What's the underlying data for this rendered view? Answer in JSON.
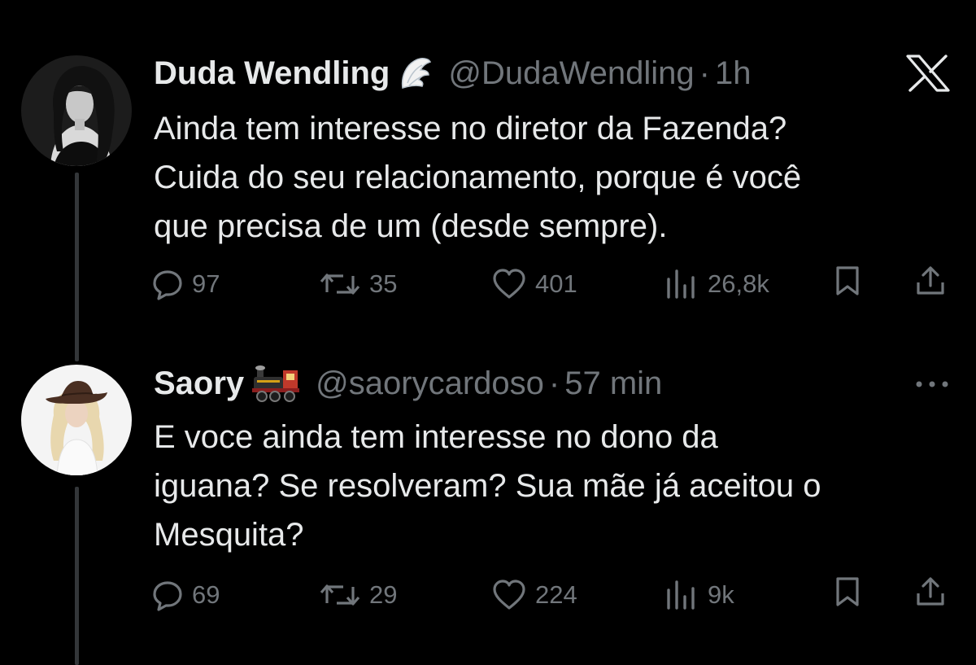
{
  "tweets": [
    {
      "display_name": "Duda Wendling",
      "badge_icon": "angel-wing-emoji",
      "handle": "@DudaWendling",
      "separator": "·",
      "time": "1h",
      "text_lines": [
        "Ainda tem interesse no diretor da Fazenda?",
        "Cuida do seu relacionamento, porque é você",
        "que precisa de um (desde sempre)."
      ],
      "stats": {
        "replies": "97",
        "reposts": "35",
        "likes": "401",
        "views": "26,8k"
      }
    },
    {
      "display_name": "Saory",
      "badge_icon": "steam-locomotive-emoji",
      "handle": "@saorycardoso",
      "separator": "·",
      "time": "57 min",
      "text_lines": [
        "E voce ainda tem interesse no dono da",
        "iguana? Se resolveram? Sua mãe já aceitou o",
        "Mesquita?"
      ],
      "stats": {
        "replies": "69",
        "reposts": "29",
        "likes": "224",
        "views": "9k"
      }
    }
  ],
  "icons": {
    "reply": "speech-bubble-icon",
    "repost": "repost-arrows-icon",
    "like": "heart-icon",
    "views": "bar-chart-icon",
    "bookmark": "bookmark-icon",
    "share": "share-upload-icon",
    "brand": "x-logo-icon",
    "more": "more-dots-icon"
  },
  "colors": {
    "background": "#000000",
    "text_primary": "#e7e9ea",
    "text_secondary": "#71767b",
    "thread_line": "#333639"
  }
}
